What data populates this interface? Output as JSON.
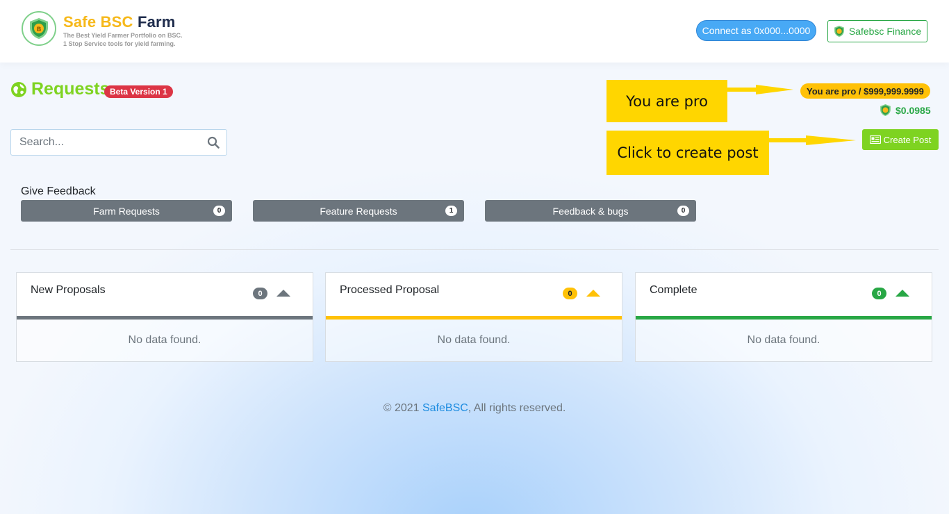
{
  "header": {
    "brand_part1": "Safe BSC",
    "brand_part2": "Farm",
    "tagline_line1": "The Best Yield Farmer Portfolio on BSC.",
    "tagline_line2": "1 Stop Service tools for yield farming.",
    "connect_label": "Connect as 0x000...0000",
    "finance_label": "Safebsc Finance"
  },
  "page": {
    "title": "Requests",
    "beta_badge": "Beta Version 1",
    "pro_badge": "You are pro / $999,999.9999",
    "price": "$0.0985",
    "create_post_label": "Create Post"
  },
  "callouts": {
    "pro": "You are pro",
    "create": "Click to create post"
  },
  "search": {
    "placeholder": "Search..."
  },
  "feedback": {
    "label": "Give Feedback",
    "buttons": [
      {
        "label": "Farm Requests",
        "count": "0"
      },
      {
        "label": "Feature Requests",
        "count": "1"
      },
      {
        "label": "Feedback & bugs",
        "count": "0"
      }
    ]
  },
  "columns": [
    {
      "title": "New Proposals",
      "count": "0",
      "color": "#6c757d",
      "empty": "No data found."
    },
    {
      "title": "Processed Proposal",
      "count": "0",
      "color": "#ffc107",
      "empty": "No data found."
    },
    {
      "title": "Complete",
      "count": "0",
      "color": "#28a745",
      "empty": "No data found."
    }
  ],
  "footer": {
    "prefix": "© 2021 ",
    "link": "SafeBSC",
    "suffix": ", All rights reserved."
  },
  "icons": {
    "logo": "shield-bitcoin-icon",
    "title": "globe-icon",
    "search": "search-icon",
    "create": "newspaper-icon"
  },
  "colors": {
    "accent_green": "#7ed321",
    "brand_yellow": "#f6b81a",
    "connect_blue": "#48a9f5",
    "badge_red": "#dc3545",
    "pro_yellow": "#ffc107",
    "callout_yellow": "#ffd600"
  }
}
